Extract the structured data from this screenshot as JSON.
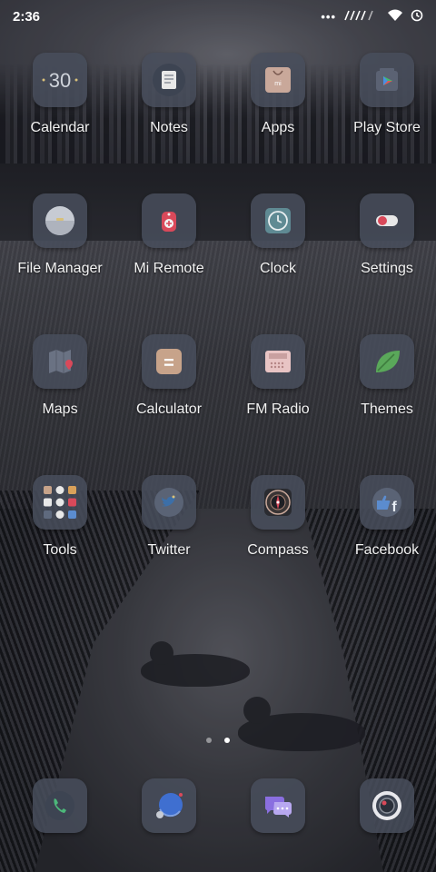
{
  "status_bar": {
    "time": "2:36",
    "dots": "•••"
  },
  "apps": [
    [
      {
        "label": "Calendar",
        "glyph": "30",
        "icon": "calendar-icon"
      },
      {
        "label": "Notes",
        "icon": "notes-icon"
      },
      {
        "label": "Apps",
        "glyph": "mi",
        "icon": "shopping-bag-icon"
      },
      {
        "label": "Play Store",
        "icon": "play-store-icon"
      }
    ],
    [
      {
        "label": "File Manager",
        "icon": "folder-icon"
      },
      {
        "label": "Mi Remote",
        "icon": "remote-icon"
      },
      {
        "label": "Clock",
        "icon": "clock-icon"
      },
      {
        "label": "Settings",
        "icon": "toggle-icon"
      }
    ],
    [
      {
        "label": "Maps",
        "icon": "map-icon"
      },
      {
        "label": "Calculator",
        "glyph": "=",
        "icon": "calculator-icon"
      },
      {
        "label": "FM Radio",
        "icon": "radio-icon"
      },
      {
        "label": "Themes",
        "icon": "leaf-icon"
      }
    ],
    [
      {
        "label": "Tools",
        "icon": "tools-folder-icon"
      },
      {
        "label": "Twitter",
        "icon": "twitter-icon"
      },
      {
        "label": "Compass",
        "icon": "compass-icon"
      },
      {
        "label": "Facebook",
        "glyph": "f",
        "icon": "facebook-icon"
      }
    ]
  ],
  "pager": {
    "count": 2,
    "active": 2
  },
  "dock": [
    {
      "icon": "phone-icon"
    },
    {
      "icon": "browser-icon"
    },
    {
      "icon": "messages-icon"
    },
    {
      "icon": "camera-icon"
    }
  ],
  "colors": {
    "icon_bg": "#484e5c",
    "notes_accent": "#e8e8e8",
    "apps_bag": "#c9a89a",
    "remote_red": "#d9495a",
    "clock_teal": "#5f8a93",
    "settings_red": "#d9495a",
    "calculator_tan": "#c7a38a",
    "radio_pink": "#e8c4c4",
    "themes_green": "#5aa85a",
    "facebook_blue": "#5b8ccf",
    "messages_purple": "#8a6fe0",
    "browser_blue": "#3f6fd0"
  }
}
